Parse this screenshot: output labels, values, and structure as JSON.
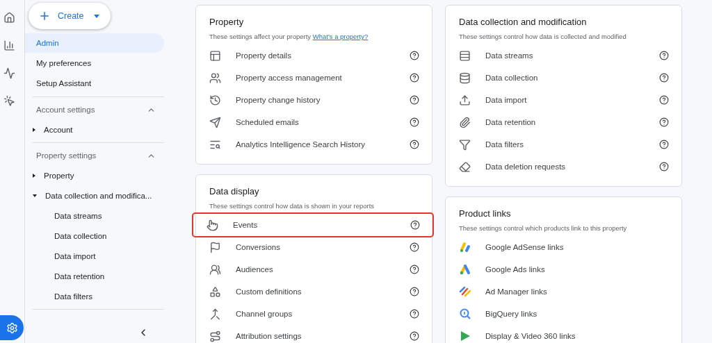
{
  "create_button": {
    "label": "Create"
  },
  "nav": [
    {
      "label": "Admin",
      "selected": true
    },
    {
      "label": "My preferences",
      "selected": false
    },
    {
      "label": "Setup Assistant",
      "selected": false
    }
  ],
  "sections": [
    {
      "title": "Account settings",
      "expanded": true,
      "items": [
        {
          "label": "Account",
          "expanded": false
        }
      ]
    },
    {
      "title": "Property settings",
      "expanded": true,
      "items": [
        {
          "label": "Property",
          "expanded": false
        },
        {
          "label": "Data collection and modifica...",
          "expanded": true,
          "children": [
            {
              "label": "Data streams"
            },
            {
              "label": "Data collection"
            },
            {
              "label": "Data import"
            },
            {
              "label": "Data retention"
            },
            {
              "label": "Data filters"
            }
          ]
        }
      ]
    }
  ],
  "rail": [
    {
      "selected": false
    },
    {
      "selected": false
    },
    {
      "selected": false
    },
    {
      "selected": false
    },
    {
      "selected": true
    }
  ],
  "cards": [
    [
      {
        "title": "Property",
        "subtitle": "These settings affect your property",
        "link": "What's a property?",
        "items": [
          {
            "label": "Property details",
            "highlighted": false
          },
          {
            "label": "Property access management",
            "highlighted": false
          },
          {
            "label": "Property change history",
            "highlighted": false
          },
          {
            "label": "Scheduled emails",
            "highlighted": false
          },
          {
            "label": "Analytics Intelligence Search History",
            "highlighted": false
          }
        ]
      },
      {
        "title": "Data display",
        "subtitle": "These settings control how data is shown in your reports",
        "items": [
          {
            "label": "Events",
            "highlighted": true
          },
          {
            "label": "Conversions",
            "highlighted": false
          },
          {
            "label": "Audiences",
            "highlighted": false
          },
          {
            "label": "Custom definitions",
            "highlighted": false
          },
          {
            "label": "Channel groups",
            "highlighted": false
          },
          {
            "label": "Attribution settings",
            "highlighted": false
          }
        ]
      }
    ],
    [
      {
        "title": "Data collection and modification",
        "subtitle": "These settings control how data is collected and modified",
        "items": [
          {
            "label": "Data streams",
            "highlighted": false
          },
          {
            "label": "Data collection",
            "highlighted": false
          },
          {
            "label": "Data import",
            "highlighted": false
          },
          {
            "label": "Data retention",
            "highlighted": false
          },
          {
            "label": "Data filters",
            "highlighted": false
          },
          {
            "label": "Data deletion requests",
            "highlighted": false
          }
        ]
      },
      {
        "title": "Product links",
        "subtitle": "These settings control which products link to this property",
        "kind": "products",
        "items": [
          {
            "label": "Google AdSense links",
            "highlighted": false
          },
          {
            "label": "Google Ads links",
            "highlighted": false
          },
          {
            "label": "Ad Manager links",
            "highlighted": false
          },
          {
            "label": "BigQuery links",
            "highlighted": false
          },
          {
            "label": "Display & Video 360 links",
            "highlighted": false
          }
        ]
      }
    ]
  ]
}
